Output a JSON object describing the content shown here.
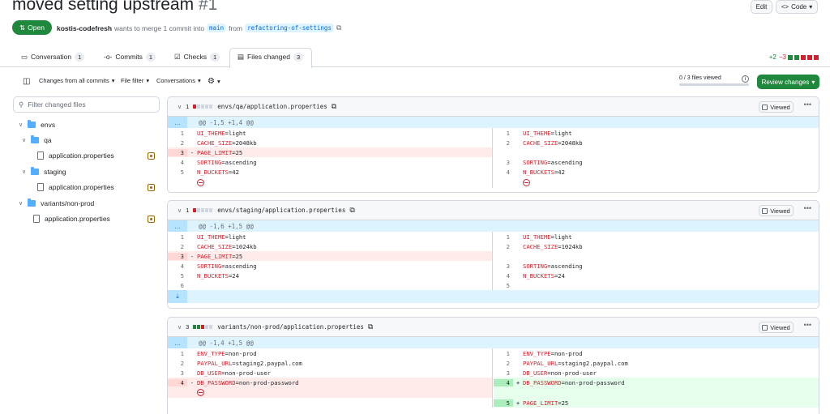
{
  "header": {
    "title": "moved setting upstream",
    "number": "#1",
    "edit_label": "Edit",
    "code_label": "Code"
  },
  "pr_meta": {
    "state": "Open",
    "author": "kostis-codefresh",
    "action": "wants to merge 1 commit into",
    "base": "main",
    "from": "from",
    "head": "refactoring-of-settings"
  },
  "tabs": [
    {
      "label": "Conversation",
      "count": "1"
    },
    {
      "label": "Commits",
      "count": "1"
    },
    {
      "label": "Checks",
      "count": "1"
    },
    {
      "label": "Files changed",
      "count": "3"
    }
  ],
  "diffstat": {
    "add": "+2",
    "del": "−3"
  },
  "toolbar": {
    "commits_filter": "Changes from all commits",
    "file_filter": "File filter",
    "conversations": "Conversations",
    "progress": "0 / 3 files viewed",
    "review": "Review changes"
  },
  "sidebar": {
    "filter_placeholder": "Filter changed files",
    "tree": [
      {
        "name": "envs"
      },
      {
        "name": "qa"
      },
      {
        "name": "application.properties"
      },
      {
        "name": "staging"
      },
      {
        "name": "application.properties"
      },
      {
        "name": "variants/non-prod"
      },
      {
        "name": "application.properties"
      }
    ]
  },
  "files": [
    {
      "count": "1",
      "path": "envs/qa/application.properties",
      "hunk": "@@ -1,5 +1,4 @@",
      "viewed_label": "Viewed",
      "left": [
        {
          "n": "1",
          "k": "UI_THEME",
          "v": "=light"
        },
        {
          "n": "2",
          "k": "CACHE_SIZE",
          "v": "=2048kb"
        },
        {
          "n": "3",
          "k": "PAGE_LIMIT",
          "v": "=25",
          "s": "-"
        },
        {
          "n": "4",
          "k": "SORTING",
          "v": "=ascending"
        },
        {
          "n": "5",
          "k": "N_BUCKETS",
          "v": "=42"
        }
      ],
      "right": [
        {
          "n": "1",
          "k": "UI_THEME",
          "v": "=light"
        },
        {
          "n": "2",
          "k": "CACHE_SIZE",
          "v": "=2048kb"
        },
        {
          "n": "",
          "k": "",
          "v": ""
        },
        {
          "n": "3",
          "k": "SORTING",
          "v": "=ascending"
        },
        {
          "n": "4",
          "k": "N_BUCKETS",
          "v": "=42"
        }
      ]
    },
    {
      "count": "1",
      "path": "envs/staging/application.properties",
      "hunk": "@@ -1,6 +1,5 @@",
      "viewed_label": "Viewed",
      "left": [
        {
          "n": "1",
          "k": "UI_THEME",
          "v": "=light"
        },
        {
          "n": "2",
          "k": "CACHE_SIZE",
          "v": "=1024kb"
        },
        {
          "n": "3",
          "k": "PAGE_LIMIT",
          "v": "=25",
          "s": "-"
        },
        {
          "n": "4",
          "k": "SORTING",
          "v": "=ascending"
        },
        {
          "n": "5",
          "k": "N_BUCKETS",
          "v": "=24"
        },
        {
          "n": "6",
          "k": "",
          "v": ""
        }
      ],
      "right": [
        {
          "n": "1",
          "k": "UI_THEME",
          "v": "=light"
        },
        {
          "n": "2",
          "k": "CACHE_SIZE",
          "v": "=1024kb"
        },
        {
          "n": "",
          "k": "",
          "v": ""
        },
        {
          "n": "3",
          "k": "SORTING",
          "v": "=ascending"
        },
        {
          "n": "4",
          "k": "N_BUCKETS",
          "v": "=24"
        },
        {
          "n": "5",
          "k": "",
          "v": ""
        }
      ]
    },
    {
      "count": "3",
      "path": "variants/non-prod/application.properties",
      "hunk": "@@ -1,4 +1,5 @@",
      "viewed_label": "Viewed",
      "left": [
        {
          "n": "1",
          "k": "ENV_TYPE",
          "v": "=non-prod"
        },
        {
          "n": "2",
          "k": "PAYPAL_URL",
          "v": "=staging2.paypal.com"
        },
        {
          "n": "3",
          "k": "DB_USER",
          "v": "=non-prod-user"
        },
        {
          "n": "4",
          "k": "DB_PASSWORD",
          "v": "=non-prod-password",
          "s": "-"
        }
      ],
      "right": [
        {
          "n": "1",
          "k": "ENV_TYPE",
          "v": "=non-prod"
        },
        {
          "n": "2",
          "k": "PAYPAL_URL",
          "v": "=staging2.paypal.com"
        },
        {
          "n": "3",
          "k": "DB_USER",
          "v": "=non-prod-user"
        },
        {
          "n": "4",
          "k": "DB_PASSWORD",
          "v": "=non-prod-password",
          "s": "+"
        },
        {
          "n": "5",
          "k": "PAGE_LIMIT",
          "v": "=25",
          "s": "+"
        }
      ]
    }
  ]
}
